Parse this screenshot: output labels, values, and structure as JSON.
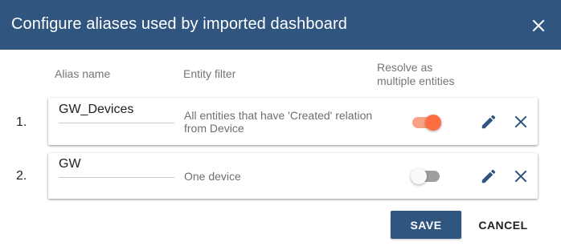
{
  "dialog": {
    "title": "Configure aliases used by imported dashboard",
    "close_icon": "close-icon"
  },
  "table": {
    "headers": {
      "alias_name": "Alias name",
      "entity_filter": "Entity filter",
      "resolve_line1": "Resolve as",
      "resolve_line2": "multiple entities"
    },
    "rows": [
      {
        "index": "1.",
        "alias": "GW_Devices",
        "filter": "All entities that have 'Created' relation from Device",
        "resolve_multiple": true,
        "edit_icon": "pencil-icon",
        "remove_icon": "close-icon"
      },
      {
        "index": "2.",
        "alias": "GW",
        "filter": "One device",
        "resolve_multiple": false,
        "edit_icon": "pencil-icon",
        "remove_icon": "close-icon"
      }
    ]
  },
  "actions": {
    "save_label": "Save",
    "cancel_label": "Cancel"
  },
  "colors": {
    "header_bg": "#305680",
    "toggle_on": "#ff6e40",
    "icon": "#305680"
  }
}
